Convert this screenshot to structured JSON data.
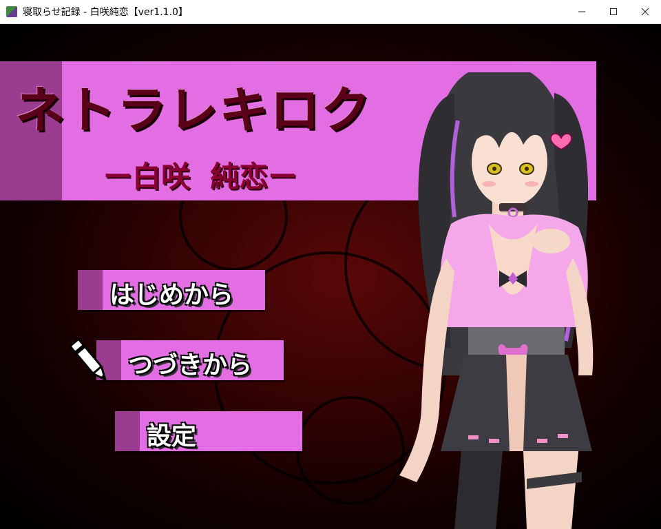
{
  "window": {
    "title": "寝取らせ記録 - 白咲純恋【ver1.1.0】",
    "controls": {
      "minimize_icon": "minimize-icon",
      "maximize_icon": "maximize-icon",
      "close_icon": "close-icon"
    }
  },
  "game": {
    "logo": {
      "main": "ネトラレキロク",
      "sub": "ー白咲  純恋ー"
    },
    "menu": {
      "items": [
        {
          "label": "はじめから"
        },
        {
          "label": "つづきから"
        },
        {
          "label": "設定"
        }
      ],
      "selected_index": 1,
      "cursor_icon": "pen-icon"
    },
    "colors": {
      "banner": "#e36ee3",
      "banner_strip": "#9a3c90",
      "background": "#350303"
    }
  }
}
